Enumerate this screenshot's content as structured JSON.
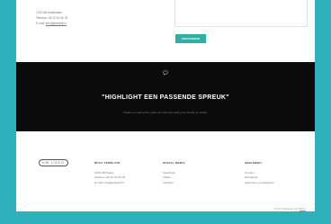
{
  "contact": {
    "address_lines": [
      "1234 AB Amsterdam",
      "Telefoon: 06 12 34 56 78"
    ],
    "email_label": "E-mail:",
    "email": "info@jebedrijf.nl",
    "resize_glyph": "⌟",
    "submit_label": "VERZENDEN"
  },
  "quote": {
    "icon": "speech-bubble-icon",
    "title": "\"HIGHLIGHT EEN PASSENDE SPREUK\"",
    "subtitle": "Plaats een passende quote die laat zien waar jouw bedrijf om draait."
  },
  "footer": {
    "logo_text": "UW LOGO",
    "columns": [
      {
        "heading": "BPCC TEMPLATE",
        "items": [
          "1234 AB Plaats",
          "Telefoon: 06 12 34 56 78",
          "E-mail: info@jebedrijf.nl"
        ]
      },
      {
        "heading": "SOCIAL MEDIA",
        "items": [
          "Facebook",
          "Twitter",
          "LinkedIn"
        ]
      },
      {
        "heading": "SNELMENU",
        "items": [
          "Contact",
          "Disclaimer",
          "Algemene voorwaarden"
        ]
      }
    ],
    "credit_text": "© 2017 Webdesign door",
    "credit_link": "BPCC"
  },
  "colors": {
    "background": "#2fb0bd",
    "button": "#2fb0a6",
    "band": "#0b0b0b"
  }
}
